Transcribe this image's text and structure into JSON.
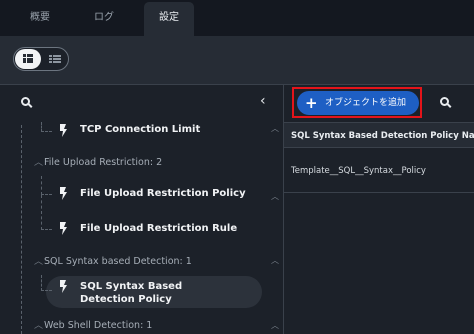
{
  "tabs": [
    {
      "label": "概要",
      "active": false
    },
    {
      "label": "ログ",
      "active": false
    },
    {
      "label": "設定",
      "active": true
    }
  ],
  "view_toggle": {
    "selected": "list-cards",
    "options": [
      "list-cards-icon",
      "table-view-icon"
    ]
  },
  "left_panel": {
    "search_icon": "search-icon",
    "collapse_icon": "chevron-left-icon",
    "tree": {
      "items": [
        {
          "type": "policy",
          "label": "TCP Connection Limit"
        },
        {
          "type": "category",
          "label": "File Upload Restriction: 2"
        },
        {
          "type": "policy",
          "label": "File Upload Restriction Policy"
        },
        {
          "type": "policy",
          "label": "File Upload Restriction Rule"
        },
        {
          "type": "category",
          "label": "SQL Syntax based Detection: 1"
        },
        {
          "type": "policy",
          "label": "SQL Syntax Based Detection Policy",
          "selected": true
        },
        {
          "type": "category",
          "label": "Web Shell Detection: 1"
        }
      ]
    }
  },
  "right_panel": {
    "add_button": "オブジェクトを追加",
    "search_icon": "search-icon",
    "table": {
      "columns": [
        "SQL Syntax Based Detection Policy Name"
      ],
      "rows": [
        [
          "Template__SQL__Syntax__Policy"
        ]
      ]
    }
  },
  "colors": {
    "accent": "#1e5fc4",
    "highlight_box": "#e4141a",
    "background": "#1c2129"
  }
}
